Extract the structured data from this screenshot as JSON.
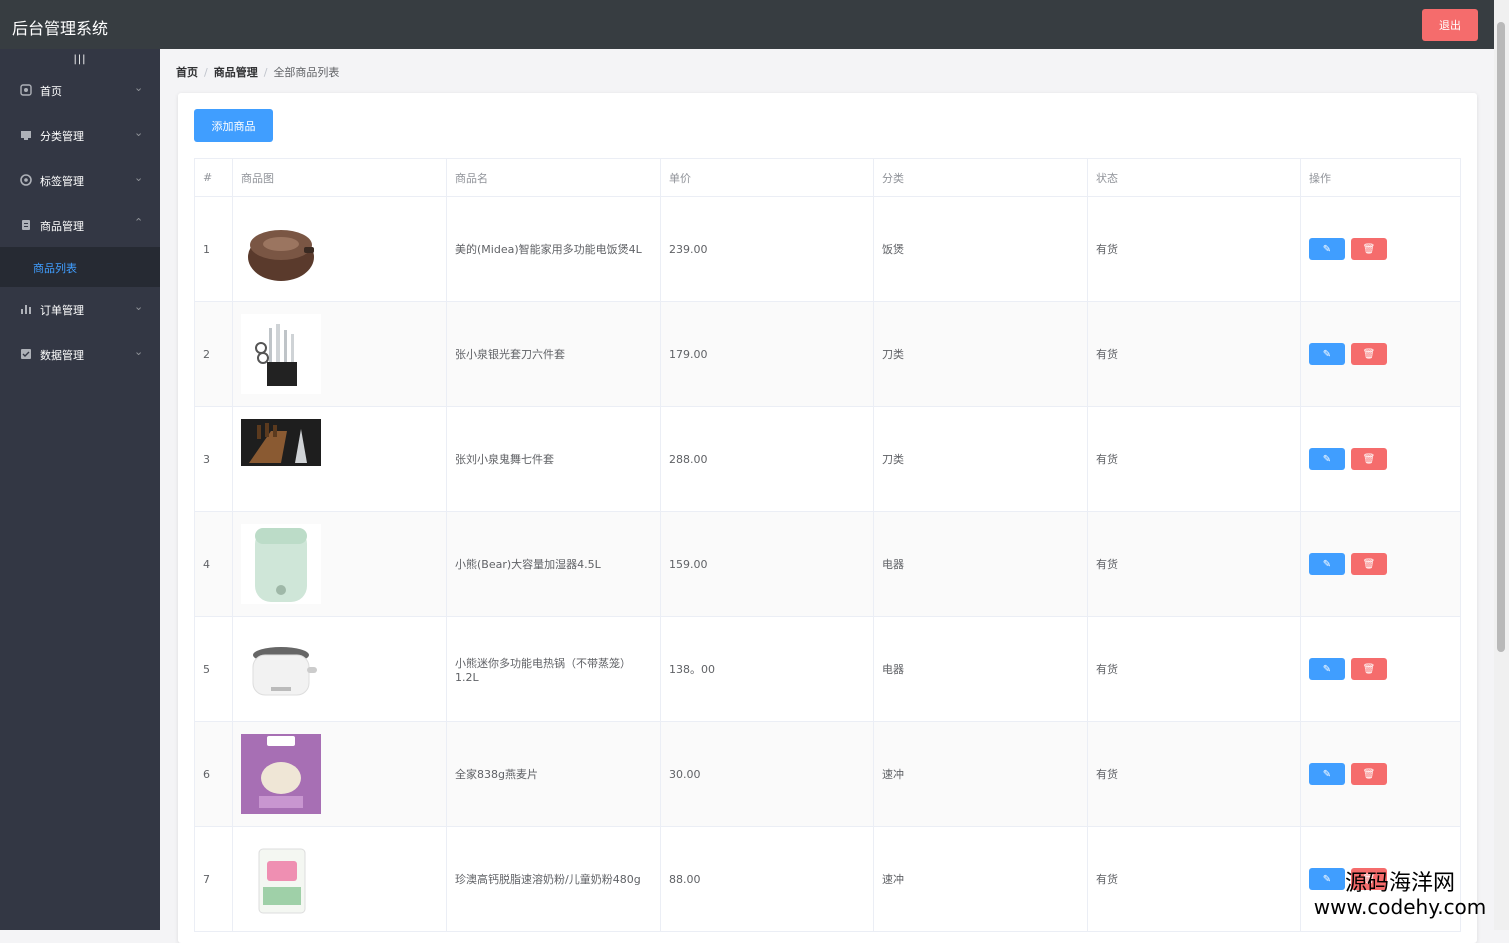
{
  "app": {
    "title": "后台管理系统",
    "logout_label": "退出"
  },
  "sidebar": {
    "toggle_label": "|||",
    "items": [
      {
        "label": "首页",
        "icon": "home-icon",
        "arrow": "⌄"
      },
      {
        "label": "分类管理",
        "icon": "category-icon",
        "arrow": "⌄"
      },
      {
        "label": "标签管理",
        "icon": "tag-icon",
        "arrow": "⌄"
      },
      {
        "label": "商品管理",
        "icon": "goods-icon",
        "arrow": "⌃"
      },
      {
        "label": "订单管理",
        "icon": "order-chart-icon",
        "arrow": "⌄"
      },
      {
        "label": "数据管理",
        "icon": "data-icon",
        "arrow": "⌄"
      }
    ],
    "submenu": {
      "label": "商品列表"
    }
  },
  "breadcrumb": [
    "首页",
    "商品管理",
    "全部商品列表"
  ],
  "toolbar": {
    "add_label": "添加商品"
  },
  "table": {
    "headers": [
      "#",
      "商品图",
      "商品名",
      "单价",
      "分类",
      "状态",
      "操作"
    ],
    "rows": [
      {
        "id": "1",
        "image": "rice-cooker-image",
        "name": "美的(Midea)智能家用多功能电饭煲4L",
        "price": "239.00",
        "category": "饭煲",
        "status": "有货"
      },
      {
        "id": "2",
        "image": "knife-set-image",
        "name": "张小泉银光套刀六件套",
        "price": "179.00",
        "category": "刀类",
        "status": "有货"
      },
      {
        "id": "3",
        "image": "knife-block-image",
        "name": "张刘小泉鬼舞七件套",
        "price": "288.00",
        "category": "刀类",
        "status": "有货"
      },
      {
        "id": "4",
        "image": "humidifier-image",
        "name": "小熊(Bear)大容量加湿器4.5L",
        "price": "159.00",
        "category": "电器",
        "status": "有货"
      },
      {
        "id": "5",
        "image": "electric-pot-image",
        "name": "小熊迷你多功能电热锅（不带蒸笼） 1.2L",
        "price": "138。00",
        "category": "电器",
        "status": "有货"
      },
      {
        "id": "6",
        "image": "oatmeal-bag-image",
        "name": "全家838g燕麦片",
        "price": "30.00",
        "category": "速冲",
        "status": "有货"
      },
      {
        "id": "7",
        "image": "milk-powder-image",
        "name": "珍澳高钙脱脂速溶奶粉/儿童奶粉480g",
        "price": "88.00",
        "category": "速冲",
        "status": "有货"
      }
    ],
    "edit_icon": "✎",
    "delete_icon": "🗑"
  },
  "watermark": {
    "line1": "源码海洋网",
    "line2": "www.codehy.com"
  },
  "colors": {
    "topbar": "#373d41",
    "sidebar": "#333744",
    "submenu_active_bg": "#262a33",
    "primary": "#409eff",
    "danger": "#f56c6c"
  }
}
